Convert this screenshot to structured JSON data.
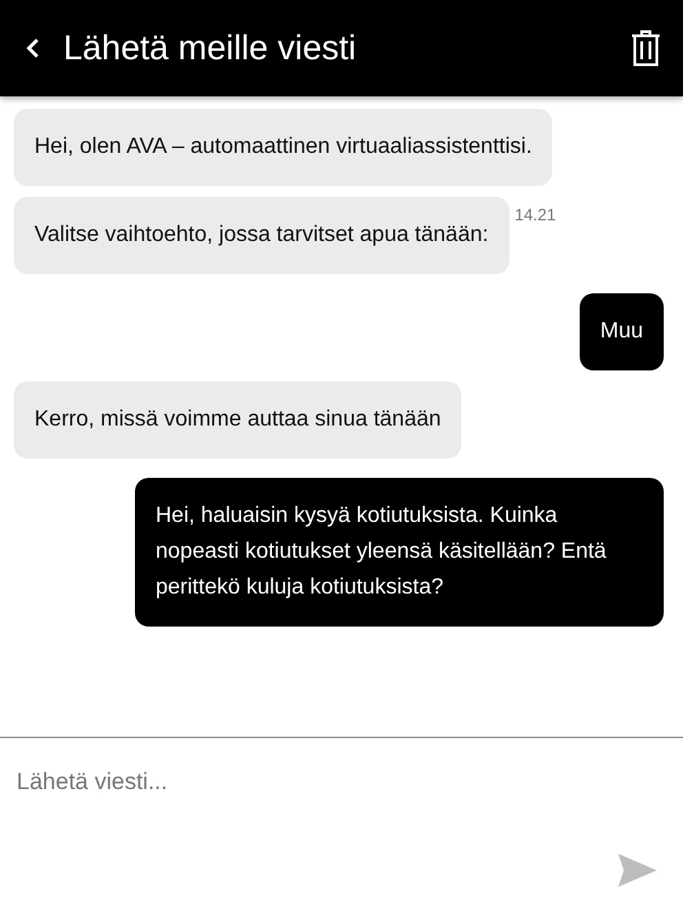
{
  "header": {
    "title": "Lähetä meille viesti"
  },
  "messages": [
    {
      "kind": "bot",
      "text": "Hei, olen AVA – automaattinen virtuaaliassistenttisi."
    },
    {
      "kind": "bot",
      "text": "Valitse vaihtoehto, jossa tarvitset apua tänään:",
      "time": "14.21"
    },
    {
      "kind": "user",
      "text": "Muu"
    },
    {
      "kind": "bot",
      "text": "Kerro, missä voimme auttaa sinua tänään"
    },
    {
      "kind": "user",
      "text": "Hei, haluaisin kysyä kotiutuksista. Kuinka nopeasti kotiutukset yleensä käsitellään? Entä perittekö kuluja kotiutuksista?"
    }
  ],
  "composer": {
    "placeholder": "Lähetä viesti..."
  }
}
